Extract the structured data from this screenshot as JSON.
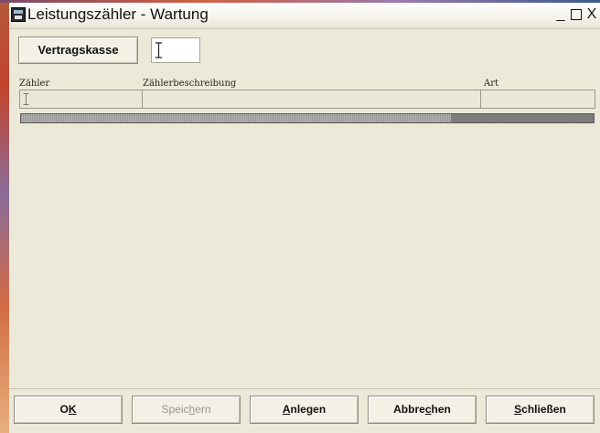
{
  "window": {
    "title": "Leistungszähler - Wartung",
    "controls": {
      "minimize": "_",
      "close": "X"
    }
  },
  "filter": {
    "button_label": "Vertragskasse",
    "input_value": ""
  },
  "grid": {
    "columns": [
      "Zähler",
      "Zählerbeschreibung",
      "Art"
    ],
    "rows": [
      {
        "zaehler": "",
        "beschreibung": "",
        "art": ""
      }
    ]
  },
  "actions": {
    "ok": {
      "pre": "O",
      "accel": "K",
      "post": ""
    },
    "speichern": {
      "pre": "Speic",
      "accel": "h",
      "post": "ern"
    },
    "anlegen": {
      "pre": "",
      "accel": "A",
      "post": "nlegen"
    },
    "abbrechen": {
      "pre": "Abbre",
      "accel": "c",
      "post": "hen"
    },
    "schliessen": {
      "pre": "",
      "accel": "S",
      "post": "chließen"
    }
  },
  "colors": {
    "window_bg": "#ece9d8",
    "disabled_text": "#9a988d"
  }
}
